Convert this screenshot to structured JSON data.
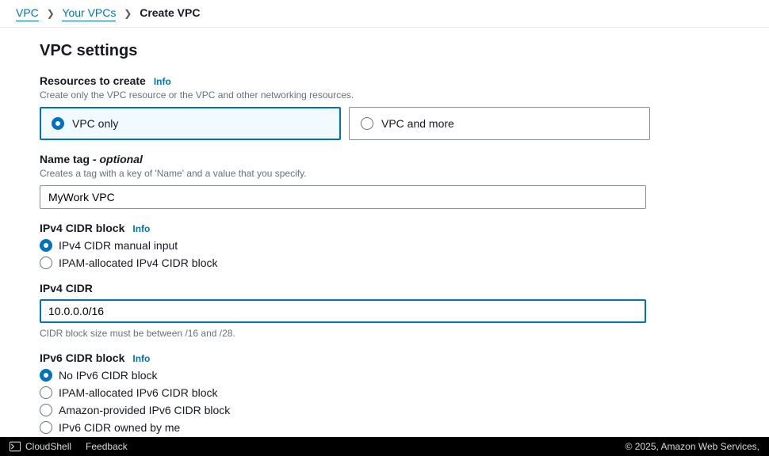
{
  "breadcrumb": {
    "root": "VPC",
    "mid": "Your VPCs",
    "current": "Create VPC"
  },
  "title": "VPC settings",
  "resources": {
    "label": "Resources to create",
    "info": "Info",
    "desc": "Create only the VPC resource or the VPC and other networking resources.",
    "option_a": "VPC only",
    "option_b": "VPC and more"
  },
  "nameTag": {
    "label": "Name tag",
    "optional": " - optional",
    "desc": "Creates a tag with a key of 'Name' and a value that you specify.",
    "value": "MyWork VPC"
  },
  "ipv4block": {
    "label": "IPv4 CIDR block",
    "info": "Info",
    "option_a": "IPv4 CIDR manual input",
    "option_b": "IPAM-allocated IPv4 CIDR block"
  },
  "ipv4cidr": {
    "label": "IPv4 CIDR",
    "value": "10.0.0.0/16",
    "help": "CIDR block size must be between /16 and /28."
  },
  "ipv6block": {
    "label": "IPv6 CIDR block",
    "info": "Info",
    "option_a": "No IPv6 CIDR block",
    "option_b": "IPAM-allocated IPv6 CIDR block",
    "option_c": "Amazon-provided IPv6 CIDR block",
    "option_d": "IPv6 CIDR owned by me"
  },
  "footer": {
    "cloudshell": "CloudShell",
    "feedback": "Feedback",
    "copyright": "© 2025, Amazon Web Services,"
  }
}
